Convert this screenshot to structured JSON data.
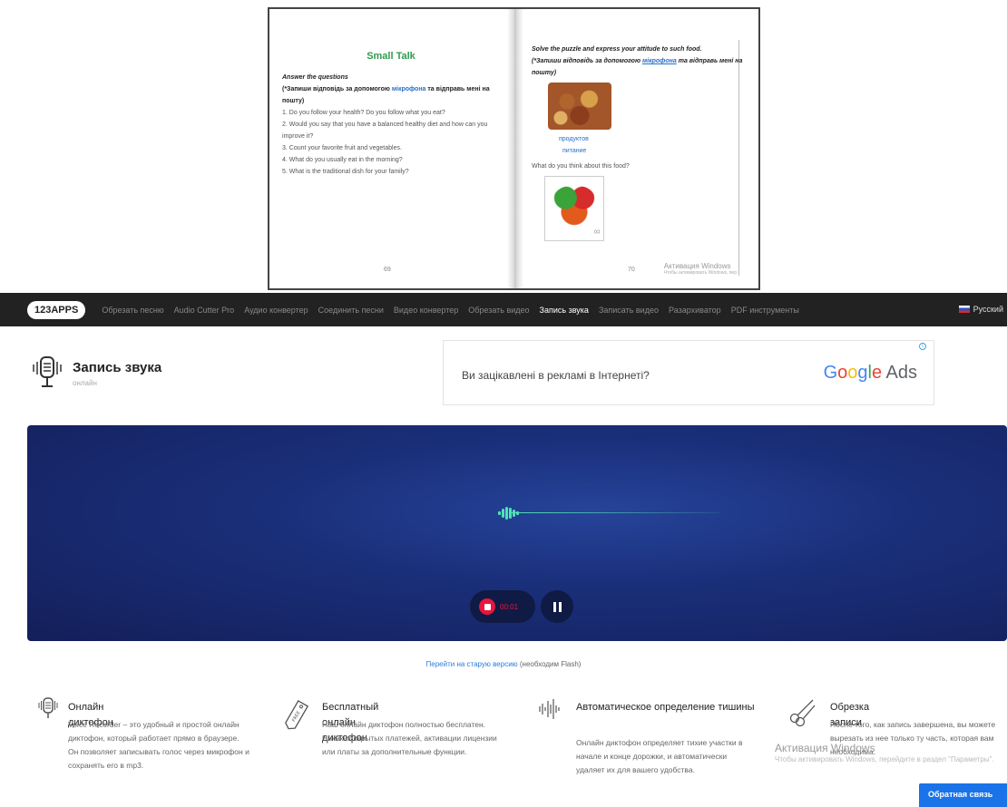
{
  "book": {
    "left": {
      "title": "Small Talk",
      "instruction": "Answer the questions",
      "note_before": "(*Запиши відповідь за допомогою ",
      "note_link": "мікрофона",
      "note_after": " та відправь мені на пошту)",
      "questions": [
        "1. Do you follow your health? Do you follow what you eat?",
        "2. Would you say that you have a balanced healthy diet and how can you improve it?",
        "3. Count your favorite fruit and vegetables.",
        "4. What do you usually eat in the morning?",
        "5. What is the traditional dish for your family?"
      ],
      "page_number": "69"
    },
    "right": {
      "instruction": "Solve the puzzle and express your attitude to such food.",
      "note_before": "(*Запиши відповідь за допомогою ",
      "note_link": "мікрофона",
      "note_after": " та відправь мені на пошту)",
      "link1": "продуктов",
      "link2": "питание",
      "question": "What do you think about this food?",
      "image_caption": "(c)",
      "page_number": "70"
    },
    "watermark": "Активация Windows",
    "watermark_sub": "Чтобы активировать Windows, пер"
  },
  "navbar": {
    "logo": "123APPS",
    "items": [
      {
        "label": "Обрезать песню",
        "active": false
      },
      {
        "label": "Audio Cutter Pro",
        "active": false
      },
      {
        "label": "Аудио конвертер",
        "active": false
      },
      {
        "label": "Соединить песни",
        "active": false
      },
      {
        "label": "Видео конвертер",
        "active": false
      },
      {
        "label": "Обрезать видео",
        "active": false
      },
      {
        "label": "Запись звука",
        "active": true
      },
      {
        "label": "Записать видео",
        "active": false
      },
      {
        "label": "Разархиватор",
        "active": false
      },
      {
        "label": "PDF инструменты",
        "active": false
      }
    ],
    "language": "Русский"
  },
  "header": {
    "title": "Запись звука",
    "subtitle": "онлайн"
  },
  "ad": {
    "text": "Ви зацікавлені в рекламі в Інтернеті?",
    "brand_google": [
      "G",
      "o",
      "o",
      "g",
      "l",
      "e"
    ],
    "brand_ads": " Ads",
    "info": "i"
  },
  "recorder": {
    "time": "00:01",
    "colors": {
      "record": "#e8153e",
      "wave": "#4fe3b4",
      "panel": "#1a2f7a"
    }
  },
  "flash": {
    "link": "Перейти на старую версию",
    "note": " (необходим Flash)"
  },
  "features": [
    {
      "title": "Онлайн диктофон",
      "text": "Voice Recorder – это удобный и простой онлайн диктофон, который работает прямо в браузере. Он позволяет записывать голос через микрофон и сохранять его в mp3.",
      "icon": "microphone-icon"
    },
    {
      "title": "Бесплатный онлайн диктофон",
      "text": "Наш онлайн диктофон полностью бесплатен. Никаких скрытых платежей, активации лицензии или платы за дополнительные функции.",
      "icon": "free-tag-icon",
      "icon_text": "FREE"
    },
    {
      "title": "Автоматическое определение тишины",
      "text": "Онлайн диктофон определяет тихие участки в начале и конце дорожки, и автоматически удаляет их для вашего удобства.",
      "icon": "waveform-icon"
    },
    {
      "title": "Обрезка записи",
      "text": "После того, как запись завершена, вы можете вырезать из нее только ту часть, которая вам необходима.",
      "icon": "scissors-icon"
    }
  ],
  "watermark": {
    "line1": "Активация Windows",
    "line2": "Чтобы активировать Windows, перейдите в раздел \"Параметры\"."
  },
  "feedback": {
    "label": "Обратная связь"
  }
}
